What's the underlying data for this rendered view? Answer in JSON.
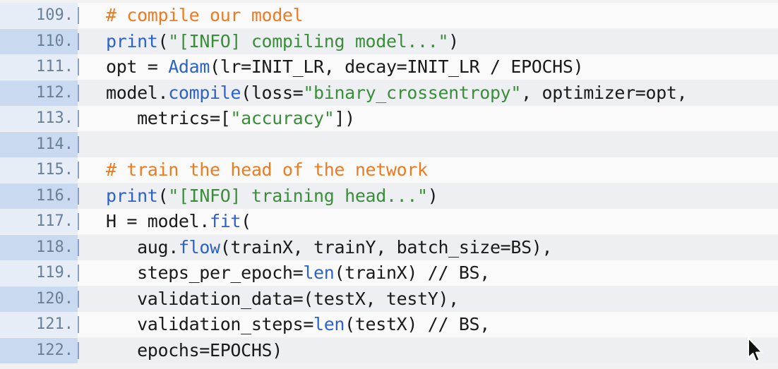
{
  "colors": {
    "default": "#1a1a1a",
    "comment": "#ec7b22",
    "string": "#3a8e3a",
    "function": "#2d62c8",
    "line_number": "#6a7f98"
  },
  "lines": [
    {
      "number": "109.",
      "tokens": [
        {
          "t": "# compile our model",
          "k": "comment"
        }
      ]
    },
    {
      "number": "110.",
      "tokens": [
        {
          "t": "print",
          "k": "func"
        },
        {
          "t": "(",
          "k": "default"
        },
        {
          "t": "\"[INFO] compiling model...\"",
          "k": "string"
        },
        {
          "t": ")",
          "k": "default"
        }
      ]
    },
    {
      "number": "111.",
      "tokens": [
        {
          "t": "opt = ",
          "k": "default"
        },
        {
          "t": "Adam",
          "k": "func"
        },
        {
          "t": "(lr=INIT_LR, decay=INIT_LR / EPOCHS)",
          "k": "default"
        }
      ]
    },
    {
      "number": "112.",
      "tokens": [
        {
          "t": "model.",
          "k": "default"
        },
        {
          "t": "compile",
          "k": "func"
        },
        {
          "t": "(loss=",
          "k": "default"
        },
        {
          "t": "\"binary_crossentropy\"",
          "k": "string"
        },
        {
          "t": ", optimizer=opt,",
          "k": "default"
        }
      ]
    },
    {
      "number": "113.",
      "tokens": [
        {
          "t": "   metrics=[",
          "k": "default"
        },
        {
          "t": "\"accuracy\"",
          "k": "string"
        },
        {
          "t": "])",
          "k": "default"
        }
      ]
    },
    {
      "number": "114.",
      "tokens": []
    },
    {
      "number": "115.",
      "tokens": [
        {
          "t": "# train the head of the network",
          "k": "comment"
        }
      ]
    },
    {
      "number": "116.",
      "tokens": [
        {
          "t": "print",
          "k": "func"
        },
        {
          "t": "(",
          "k": "default"
        },
        {
          "t": "\"[INFO] training head...\"",
          "k": "string"
        },
        {
          "t": ")",
          "k": "default"
        }
      ]
    },
    {
      "number": "117.",
      "tokens": [
        {
          "t": "H = model.",
          "k": "default"
        },
        {
          "t": "fit",
          "k": "func"
        },
        {
          "t": "(",
          "k": "default"
        }
      ]
    },
    {
      "number": "118.",
      "tokens": [
        {
          "t": "   aug.",
          "k": "default"
        },
        {
          "t": "flow",
          "k": "func"
        },
        {
          "t": "(trainX, trainY, batch_size=BS),",
          "k": "default"
        }
      ]
    },
    {
      "number": "119.",
      "tokens": [
        {
          "t": "   steps_per_epoch=",
          "k": "default"
        },
        {
          "t": "len",
          "k": "func"
        },
        {
          "t": "(trainX) // BS,",
          "k": "default"
        }
      ]
    },
    {
      "number": "120.",
      "tokens": [
        {
          "t": "   validation_data=(testX, testY),",
          "k": "default"
        }
      ]
    },
    {
      "number": "121.",
      "tokens": [
        {
          "t": "   validation_steps=",
          "k": "default"
        },
        {
          "t": "len",
          "k": "func"
        },
        {
          "t": "(testX) // BS,",
          "k": "default"
        }
      ]
    },
    {
      "number": "122.",
      "tokens": [
        {
          "t": "   epochs=EPOCHS)",
          "k": "default"
        }
      ]
    }
  ],
  "cursor": {
    "icon": "mouse-pointer-icon"
  }
}
